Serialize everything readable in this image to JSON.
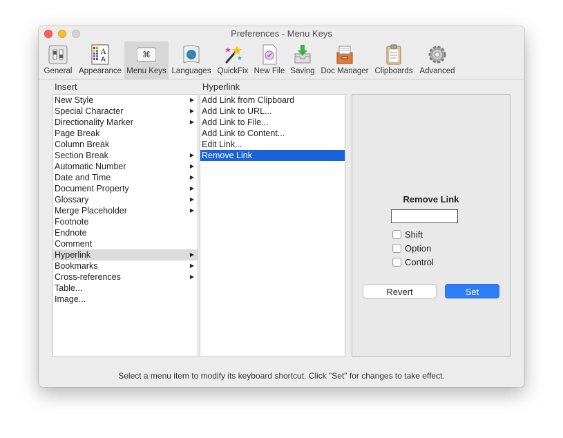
{
  "window": {
    "title": "Preferences - Menu Keys"
  },
  "toolbar": {
    "items": [
      {
        "label": "General"
      },
      {
        "label": "Appearance"
      },
      {
        "label": "Menu Keys"
      },
      {
        "label": "Languages"
      },
      {
        "label": "QuickFix"
      },
      {
        "label": "New File"
      },
      {
        "label": "Saving"
      },
      {
        "label": "Doc Manager"
      },
      {
        "label": "Clipboards"
      },
      {
        "label": "Advanced"
      }
    ],
    "selected": "Menu Keys"
  },
  "insert": {
    "header": "Insert",
    "items": [
      {
        "label": "New Style",
        "submenu": true
      },
      {
        "label": "Special Character",
        "submenu": true
      },
      {
        "label": "Directionality Marker",
        "submenu": true
      },
      {
        "label": "Page Break",
        "submenu": false
      },
      {
        "label": "Column Break",
        "submenu": false
      },
      {
        "label": "Section Break",
        "submenu": true
      },
      {
        "label": "Automatic Number",
        "submenu": true
      },
      {
        "label": "Date and Time",
        "submenu": true
      },
      {
        "label": "Document Property",
        "submenu": true
      },
      {
        "label": "Glossary",
        "submenu": true
      },
      {
        "label": "Merge Placeholder",
        "submenu": true
      },
      {
        "label": "Footnote",
        "submenu": false
      },
      {
        "label": "Endnote",
        "submenu": false
      },
      {
        "label": "Comment",
        "submenu": false
      },
      {
        "label": "Hyperlink",
        "submenu": true
      },
      {
        "label": "Bookmarks",
        "submenu": true
      },
      {
        "label": "Cross-references",
        "submenu": true
      },
      {
        "label": "Table...",
        "submenu": false
      },
      {
        "label": "Image...",
        "submenu": false
      }
    ],
    "selected": "Hyperlink"
  },
  "hyperlink": {
    "header": "Hyperlink",
    "items": [
      {
        "label": "Add Link from Clipboard"
      },
      {
        "label": "Add Link to URL..."
      },
      {
        "label": "Add Link to File..."
      },
      {
        "label": "Add Link to Content..."
      },
      {
        "label": "Edit Link..."
      },
      {
        "label": "Remove Link"
      }
    ],
    "selected": "Remove Link"
  },
  "detail": {
    "title": "Remove Link",
    "shortcut_value": "",
    "modifiers": [
      {
        "label": "Shift",
        "checked": false
      },
      {
        "label": "Option",
        "checked": false
      },
      {
        "label": "Control",
        "checked": false
      }
    ],
    "revert_label": "Revert",
    "set_label": "Set"
  },
  "footer": {
    "text": "Select a menu item to modify its keyboard shortcut.  Click \"Set\" for changes to take effect."
  },
  "colors": {
    "selection_blue": "#1a62d8",
    "set_button": "#2f7cf6",
    "row_highlight": "#dcdcdc"
  }
}
